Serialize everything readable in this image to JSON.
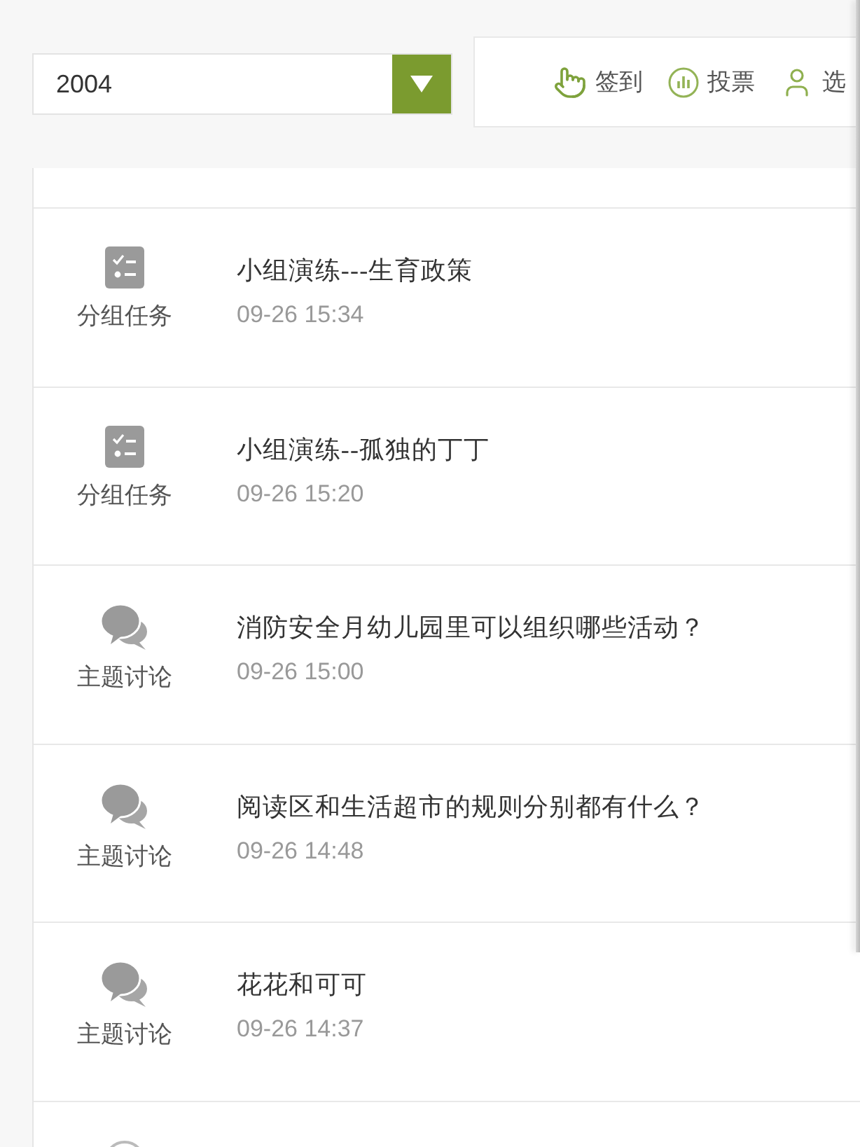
{
  "year_select": {
    "value": "2004"
  },
  "toolbar": {
    "items": [
      {
        "kind": "checkin",
        "label": "签到"
      },
      {
        "kind": "vote",
        "label": "投票"
      },
      {
        "kind": "user",
        "label": "选"
      }
    ]
  },
  "feed": {
    "items": [
      {
        "kind": "task",
        "category": "分组任务",
        "title": "小组演练---生育政策",
        "time": "09-26 15:34"
      },
      {
        "kind": "task",
        "category": "分组任务",
        "title": "小组演练--孤独的丁丁",
        "time": "09-26 15:20"
      },
      {
        "kind": "discussion",
        "category": "主题讨论",
        "title": "消防安全月幼儿园里可以组织哪些活动？",
        "time": "09-26 15:00"
      },
      {
        "kind": "discussion",
        "category": "主题讨论",
        "title": "阅读区和生活超市的规则分别都有什么？",
        "time": "09-26 14:48"
      },
      {
        "kind": "discussion",
        "category": "主题讨论",
        "title": "花花和可可",
        "time": "09-26 14:37"
      },
      {
        "kind": "ring"
      }
    ]
  }
}
